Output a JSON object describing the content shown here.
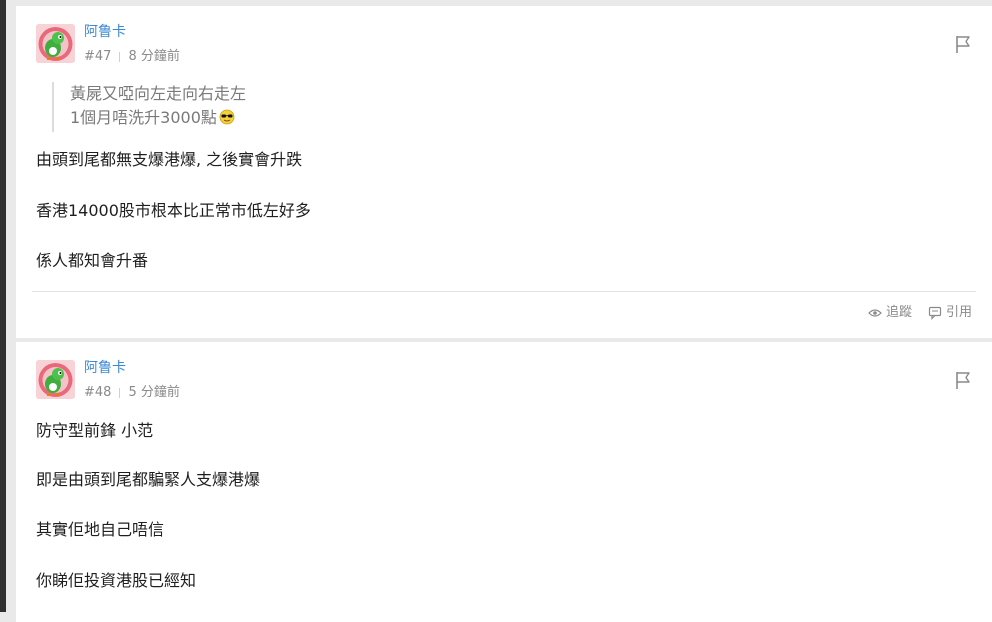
{
  "posts": [
    {
      "username": "阿鲁卡",
      "number": "#47",
      "time": "8 分鐘前",
      "quote": {
        "lines": [
          "黃屍又啞向左走向右走左",
          "1個月唔洗升3000點"
        ],
        "emoji": "sunglasses-emoji"
      },
      "paragraphs": [
        "由頭到尾都無支爆港爆, 之後實會升跌",
        "香港14000股市根本比正常市低左好多",
        "係人都知會升番"
      ],
      "actions": {
        "follow": "追蹤",
        "quote": "引用"
      }
    },
    {
      "username": "阿鲁卡",
      "number": "#48",
      "time": "5 分鐘前",
      "paragraphs": [
        "防守型前鋒 小范",
        "即是由頭到尾都騙緊人支爆港爆",
        "其實佢地自己唔信",
        "你睇佢投資港股已經知"
      ]
    }
  ],
  "icons": {
    "flag": "flag-icon",
    "follow": "eye-icon",
    "quote": "quote-icon"
  },
  "colors": {
    "username": "#3c8ad6",
    "meta": "#8a8a8a",
    "background": "#e9e9e9",
    "card": "#ffffff"
  }
}
